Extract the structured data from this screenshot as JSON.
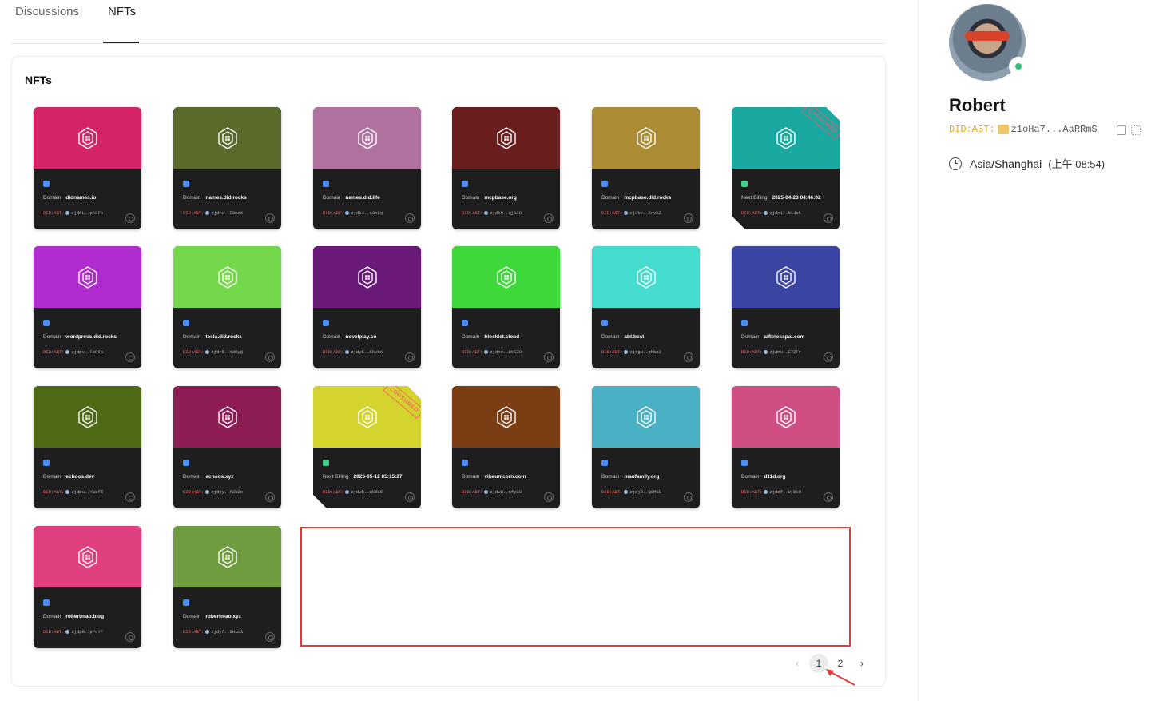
{
  "tabs": [
    {
      "label": "Discussions",
      "active": false
    },
    {
      "label": "NFTs",
      "active": true
    }
  ],
  "panel": {
    "title": "NFTs"
  },
  "cards": [
    {
      "color": "#d42366",
      "label": "Domain",
      "value": "didnames.io",
      "did_prefix": "DID:ABT:",
      "addr": "zjdkL..pC8Fo",
      "consumed": false
    },
    {
      "color": "#5a6a2a",
      "label": "Domain",
      "value": "names.did.rocks",
      "did_prefix": "DID:ABT:",
      "addr": "zjdru..E8mxX",
      "consumed": false
    },
    {
      "color": "#b0739f",
      "label": "Domain",
      "value": "names.did.life",
      "did_prefix": "DID:ABT:",
      "addr": "zjdkJ..n3nLq",
      "consumed": false
    },
    {
      "color": "#6b1e1e",
      "label": "Domain",
      "value": "mcpbase.org",
      "did_prefix": "DID:ABT:",
      "addr": "zjdk9..qjG1S",
      "consumed": false
    },
    {
      "color": "#ab8b33",
      "label": "Domain",
      "value": "mcpbase.did.rocks",
      "did_prefix": "DID:ABT:",
      "addr": "zjdkt..KrvhZ",
      "consumed": false
    },
    {
      "color": "#1aa9a0",
      "label": "Next Billing",
      "value": "2025-04-23 04:46:02",
      "did_prefix": "DID:ABT:",
      "addr": "zjdn1..N1Jsk",
      "consumed": true,
      "consumed_label": "CONSUMED"
    },
    {
      "color": "#b12ccf",
      "label": "Domain",
      "value": "wordpress.did.rocks",
      "did_prefix": "DID:ABT:",
      "addr": "zjdpv..FeR9k",
      "consumed": false
    },
    {
      "color": "#74d94a",
      "label": "Domain",
      "value": "tesla.did.rocks",
      "did_prefix": "DID:ABT:",
      "addr": "zjdr5..YWKyQ",
      "consumed": false
    },
    {
      "color": "#6a1978",
      "label": "Domain",
      "value": "novelplay.co",
      "did_prefix": "DID:ABT:",
      "addr": "zjdy5..S9vhX",
      "consumed": false
    },
    {
      "color": "#3ed83a",
      "label": "Domain",
      "value": "blocklet.cloud",
      "did_prefix": "DID:ABT:",
      "addr": "zjdnv..DtEZ9",
      "consumed": false
    },
    {
      "color": "#43dccf",
      "label": "Domain",
      "value": "abt.best",
      "did_prefix": "DID:ABT:",
      "addr": "zjdgN..pMbp2",
      "consumed": false
    },
    {
      "color": "#3a44a1",
      "label": "Domain",
      "value": "aifitnesspal.com",
      "did_prefix": "DID:ABT:",
      "addr": "zjdnu..E7ZFr",
      "consumed": false
    },
    {
      "color": "#4f6a14",
      "label": "Domain",
      "value": "echoos.dev",
      "did_prefix": "DID:ABT:",
      "addr": "zjdpu..YaLfZ",
      "consumed": false
    },
    {
      "color": "#8e1c55",
      "label": "Domain",
      "value": "echoos.xyz",
      "did_prefix": "DID:ABT:",
      "addr": "zjdjy..PZk2c",
      "consumed": false
    },
    {
      "color": "#d4d42f",
      "label": "Next Billing",
      "value": "2025-05-12 05:15:27",
      "did_prefix": "DID:ABT:",
      "addr": "zjdwh..qkZC5",
      "consumed": true,
      "consumed_label": "CONSUMED"
    },
    {
      "color": "#7b3e14",
      "label": "Domain",
      "value": "vibeunicorn.com",
      "did_prefix": "DID:ABT:",
      "addr": "zjdwQ..nfy3S",
      "consumed": false
    },
    {
      "color": "#4ab1c4",
      "label": "Domain",
      "value": "maofamily.org",
      "did_prefix": "DID:ABT:",
      "addr": "zjdjR..Q8MGE",
      "consumed": false
    },
    {
      "color": "#cf4f84",
      "label": "Domain",
      "value": "d11d.org",
      "did_prefix": "DID:ABT:",
      "addr": "zjdzf..UjBc9",
      "consumed": false
    },
    {
      "color": "#e0407f",
      "label": "Domain",
      "value": "robertmao.blog",
      "did_prefix": "DID:ABT:",
      "addr": "zjdpR..pPoYF",
      "consumed": false
    },
    {
      "color": "#6e9c3e",
      "label": "Domain",
      "value": "robertmao.xyz",
      "did_prefix": "DID:ABT:",
      "addr": "zjdyf..6HimS",
      "consumed": false
    }
  ],
  "pagination": {
    "prev": "‹",
    "pages": [
      "1",
      "2"
    ],
    "current": "1",
    "next": "›"
  },
  "profile": {
    "name": "Robert",
    "did_label": "DID:ABT:",
    "did_short": "z1oHa7...AaRRmS",
    "timezone": "Asia/Shanghai",
    "local_time": "(上午 08:54)",
    "status": "online"
  }
}
